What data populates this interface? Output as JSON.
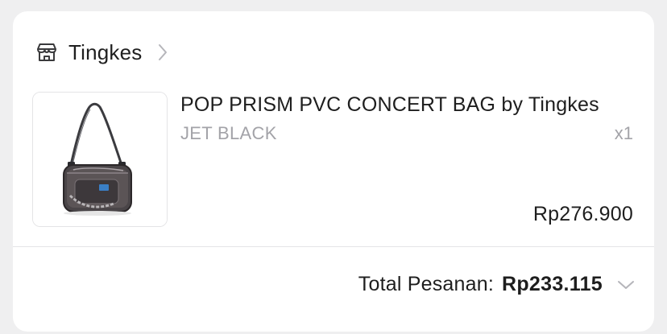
{
  "shop": {
    "name": "Tingkes",
    "icon": "store-icon"
  },
  "product": {
    "title": "POP PRISM PVC CONCERT BAG by Tingkes",
    "variant": "JET BLACK",
    "quantity": "x1",
    "price": "Rp276.900",
    "image_icon": "shoulder-bag-image"
  },
  "order": {
    "total_label": "Total Pesanan:",
    "total_value": "Rp233.115"
  },
  "colors": {
    "background": "#efeff0",
    "card": "#ffffff",
    "text_primary": "#1e1e1e",
    "text_muted": "#a3a3a8"
  }
}
